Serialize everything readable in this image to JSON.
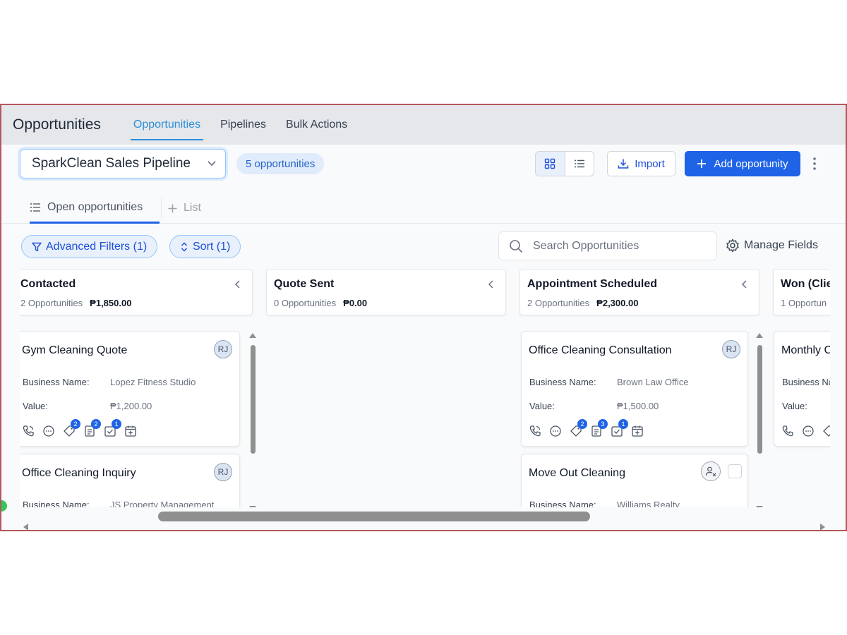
{
  "header": {
    "app_title": "Opportunities",
    "tabs": [
      {
        "label": "Opportunities",
        "active": true
      },
      {
        "label": "Pipelines",
        "active": false
      },
      {
        "label": "Bulk Actions",
        "active": false
      }
    ]
  },
  "toolbar": {
    "pipeline_selected": "SparkClean Sales Pipeline",
    "opportunity_count": "5 opportunities",
    "import_label": "Import",
    "add_label": "Add opportunity"
  },
  "subtabs": {
    "open_label": "Open opportunities",
    "add_list_label": "List"
  },
  "filters": {
    "advanced_label": "Advanced Filters (1)",
    "sort_label": "Sort (1)",
    "search_placeholder": "Search Opportunities",
    "manage_fields_label": "Manage Fields"
  },
  "columns": [
    {
      "title": "Contacted",
      "count": "2 Opportunities",
      "total": "₱1,850.00"
    },
    {
      "title": "Quote Sent",
      "count": "0 Opportunities",
      "total": "₱0.00"
    },
    {
      "title": "Appointment Scheduled",
      "count": "2 Opportunities",
      "total": "₱2,300.00"
    },
    {
      "title": "Won (Clie",
      "count": "1 Opportun",
      "total": ""
    }
  ],
  "labels": {
    "business_name": "Business Name:",
    "value": "Value:"
  },
  "cards": [
    {
      "title": "Gym Cleaning Quote",
      "assignee": "RJ",
      "business": "Lopez Fitness Studio",
      "value": "₱1,200.00",
      "badges": {
        "tag": "2",
        "note": "2",
        "task": "1"
      }
    },
    {
      "title": "Office Cleaning Inquiry",
      "assignee": "RJ",
      "business": "JS Property Management",
      "value": ""
    },
    {
      "title": "Office Cleaning Consultation",
      "assignee": "RJ",
      "business": "Brown Law Office",
      "value": "₱1,500.00",
      "badges": {
        "tag": "2",
        "note": "3",
        "task": "1"
      }
    },
    {
      "title": "Move Out Cleaning",
      "assignee": "",
      "business": "Williams Realty",
      "value": ""
    },
    {
      "title": "Monthly C",
      "assignee": "",
      "business": "",
      "value": ""
    }
  ],
  "colors": {
    "accent": "#1f63e6",
    "tab_active": "#2f8ed8",
    "frame_border": "#b5565c"
  },
  "icons": [
    "phone-icon",
    "chat-icon",
    "tag-icon",
    "note-icon",
    "task-icon",
    "calendar-add-icon",
    "grid-view-icon",
    "list-view-icon",
    "import-icon",
    "plus-icon",
    "kebab-icon",
    "filter-icon",
    "sort-icon",
    "search-icon",
    "gear-icon",
    "chevron-down-icon",
    "chevron-left-icon",
    "unassigned-user-icon"
  ]
}
